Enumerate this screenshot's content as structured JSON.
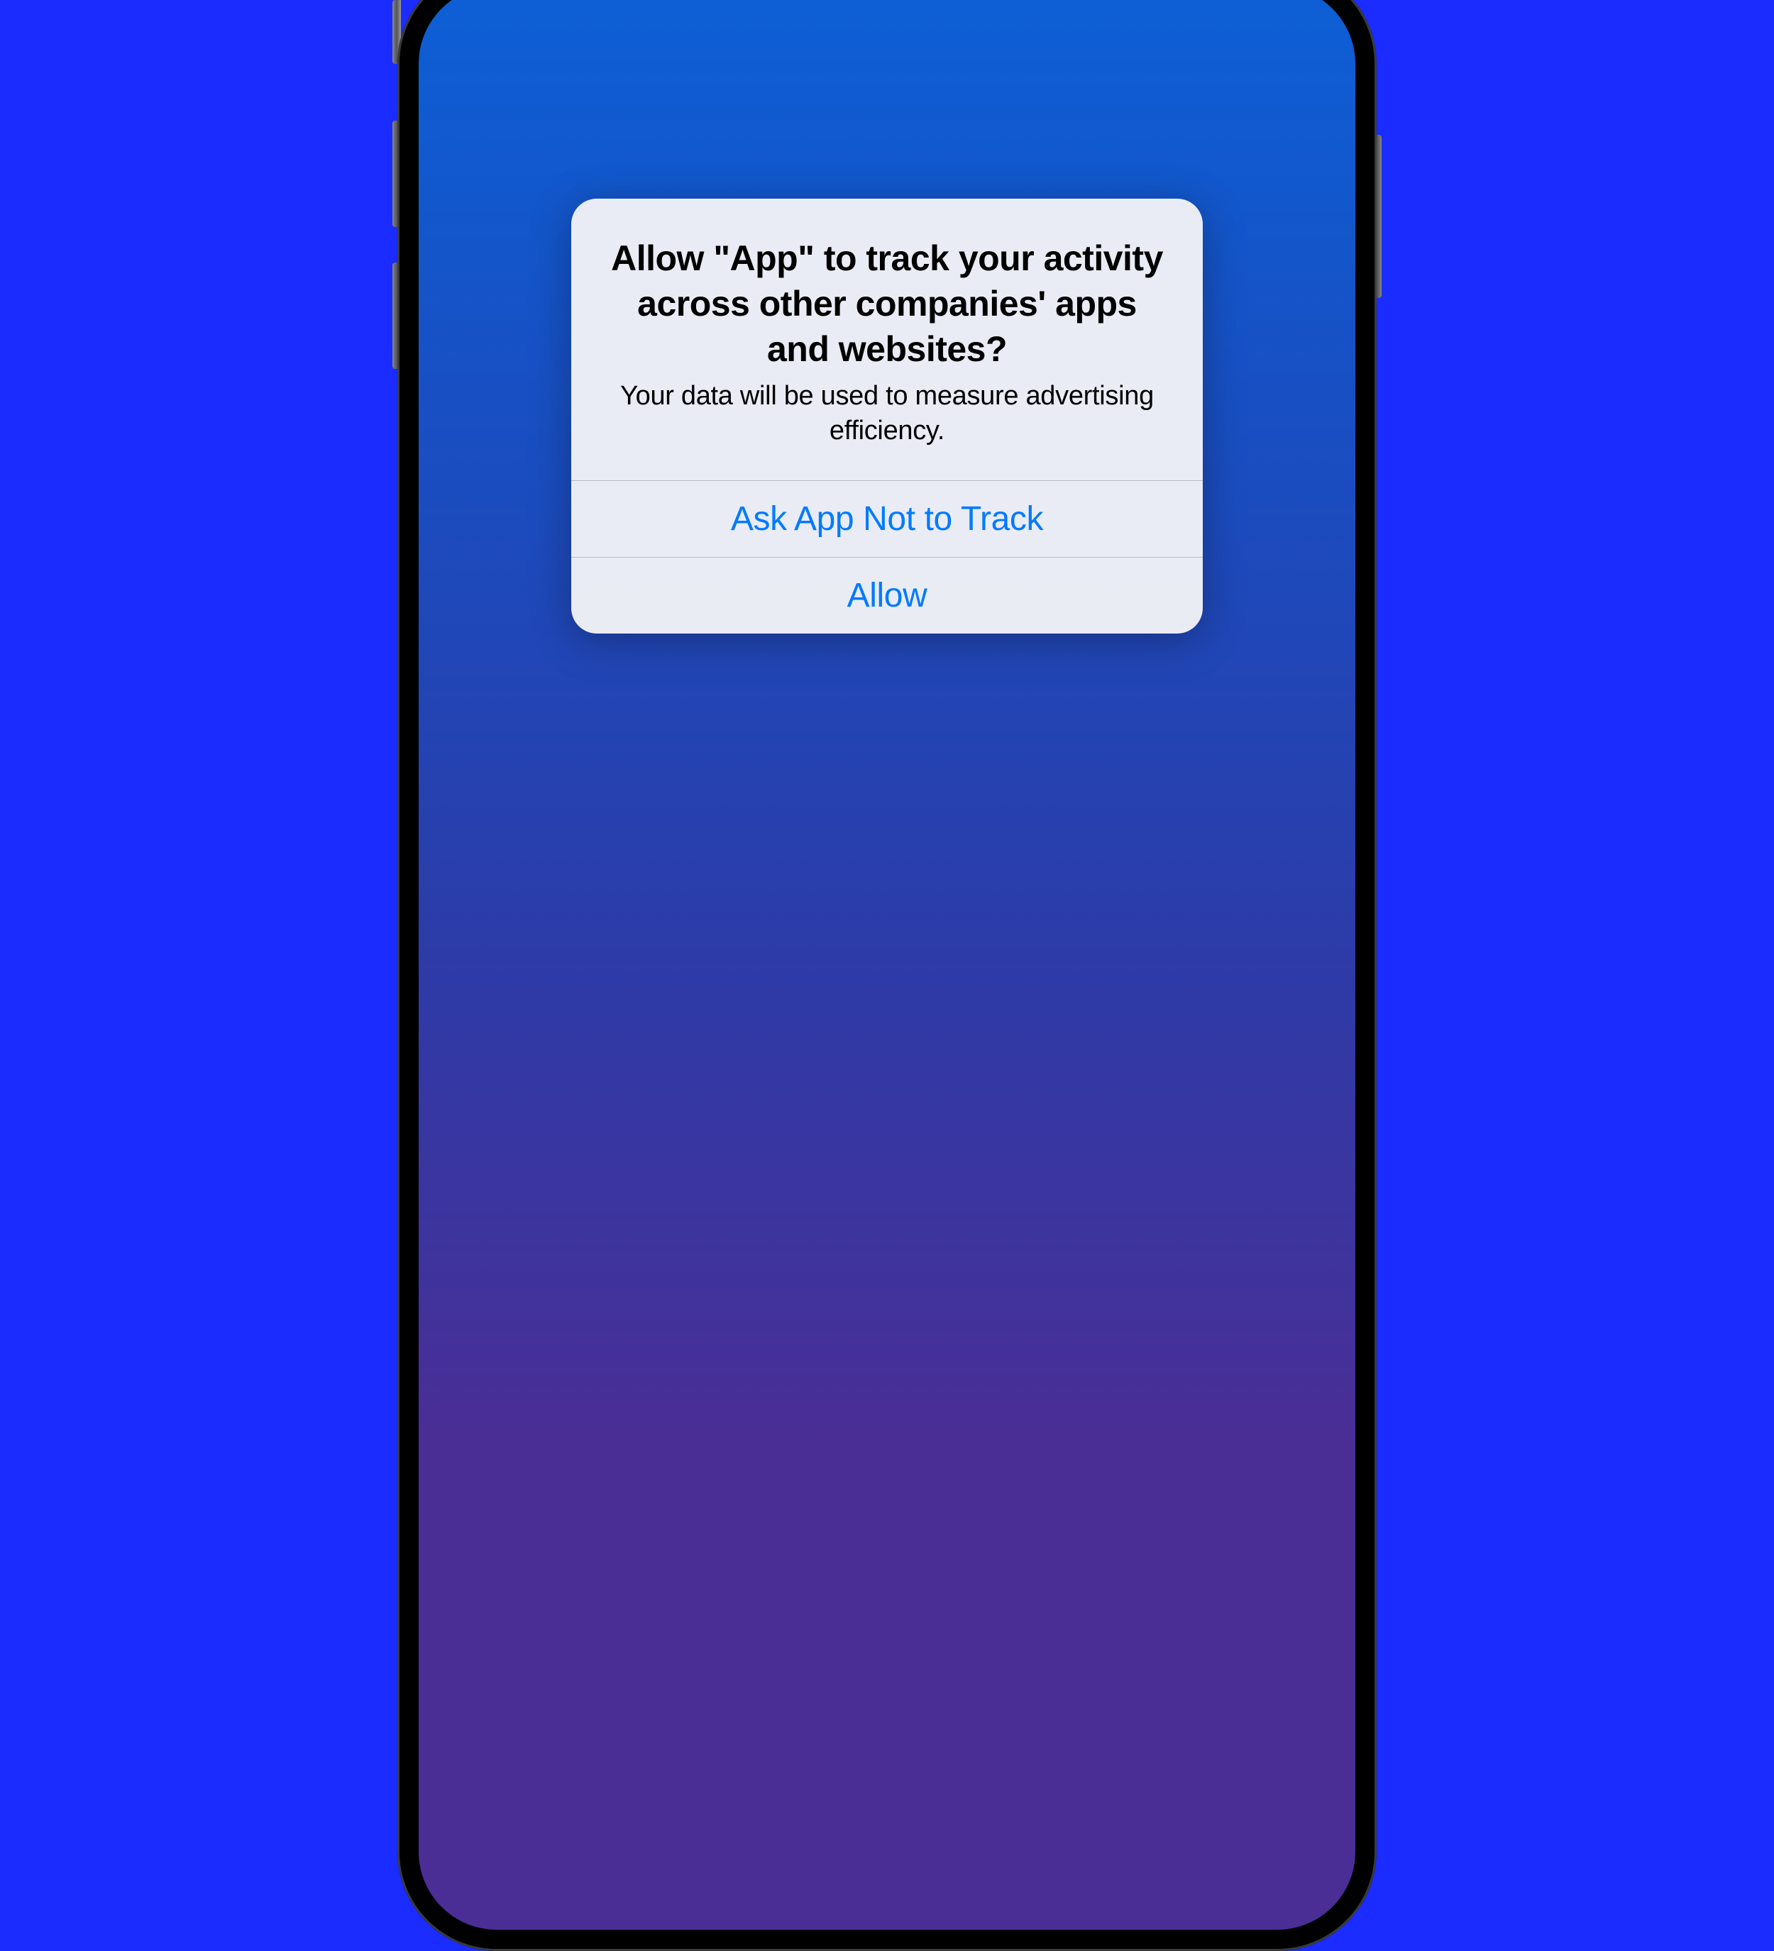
{
  "dialog": {
    "title": "Allow \"App\" to track your activity across other companies' apps and websites?",
    "subtitle": "Your data will be used to measure advertising efficiency.",
    "buttons": {
      "deny": "Ask App Not to Track",
      "allow": "Allow"
    }
  }
}
